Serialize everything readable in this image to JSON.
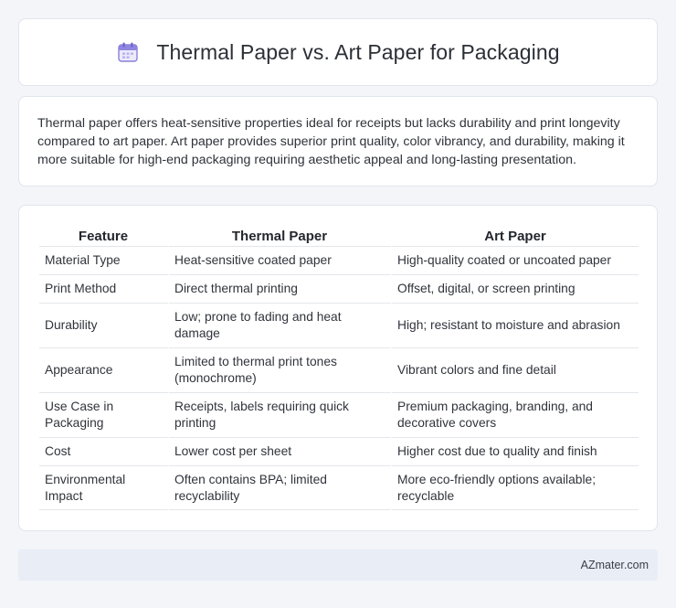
{
  "header": {
    "icon": "calendar-icon",
    "title": "Thermal Paper vs. Art Paper for Packaging"
  },
  "summary": {
    "text": "Thermal paper offers heat-sensitive properties ideal for receipts but lacks durability and print longevity compared to art paper. Art paper provides superior print quality, color vibrancy, and durability, making it more suitable for high-end packaging requiring aesthetic appeal and long-lasting presentation."
  },
  "table": {
    "headers": [
      "Feature",
      "Thermal Paper",
      "Art Paper"
    ],
    "rows": [
      [
        "Material Type",
        "Heat-sensitive coated paper",
        "High-quality coated or uncoated paper"
      ],
      [
        "Print Method",
        "Direct thermal printing",
        "Offset, digital, or screen printing"
      ],
      [
        "Durability",
        "Low; prone to fading and heat damage",
        "High; resistant to moisture and abrasion"
      ],
      [
        "Appearance",
        "Limited to thermal print tones (monochrome)",
        "Vibrant colors and fine detail"
      ],
      [
        "Use Case in Packaging",
        "Receipts, labels requiring quick printing",
        "Premium packaging, branding, and decorative covers"
      ],
      [
        "Cost",
        "Lower cost per sheet",
        "Higher cost due to quality and finish"
      ],
      [
        "Environmental Impact",
        "Often contains BPA; limited recyclability",
        "More eco-friendly options available; recyclable"
      ]
    ]
  },
  "footer": {
    "text": "AZmater.com"
  },
  "colors": {
    "background": "#f3f5f9",
    "card": "#ffffff",
    "footer_bg": "#e8edf6",
    "icon_accent": "#7b6fd6"
  }
}
